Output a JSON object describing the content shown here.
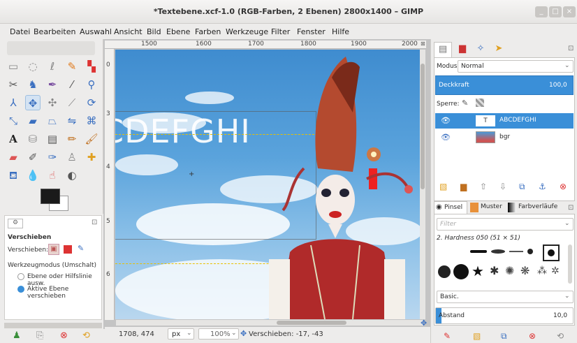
{
  "window": {
    "title": "*Textebene.xcf-1.0 (RGB-Farben, 2 Ebenen) 2800x1400 – GIMP",
    "minimize_glyph": "_",
    "maximize_glyph": "□",
    "close_glyph": "×"
  },
  "menu": [
    "Datei",
    "Bearbeiten",
    "Auswahl",
    "Ansicht",
    "Bild",
    "Ebene",
    "Farben",
    "Werkzeuge",
    "Filter",
    "Fenster",
    "Hilfe"
  ],
  "ruler": {
    "h_ticks": [
      "1500",
      "1600",
      "1700",
      "1800",
      "1900",
      "2000"
    ],
    "v_ticks": [
      "0",
      "3",
      "4",
      "5",
      "6"
    ]
  },
  "canvas": {
    "text_layer": "CDEFGHI"
  },
  "tool_options": {
    "title": "Verschieben",
    "move_label": "Verschieben:",
    "mode_label": "Werkzeugmodus (Umschalt)",
    "option_1": "Ebene oder Hilfslinie ausw.",
    "option_2": "Aktive Ebene verschieben",
    "selected_option": 2
  },
  "status": {
    "coords": "1708, 474",
    "unit": "px",
    "zoom": "100%",
    "message": "Verschieben: -17, -43"
  },
  "layers": {
    "mode_label": "Modus:",
    "mode_value": "Normal",
    "opacity_label": "Deckkraft",
    "opacity_value": "100,0",
    "lock_label": "Sperre:",
    "items": [
      {
        "name": "ABCDEFGHI",
        "selected": true
      },
      {
        "name": "bgr",
        "selected": false
      }
    ]
  },
  "brushes": {
    "tabs": [
      "Pinsel",
      "Muster",
      "Farbverläufe"
    ],
    "filter_placeholder": "Filter",
    "current_brush": "2. Hardness 050 (51 × 51)",
    "preset": "Basic.",
    "spacing_label": "Abstand",
    "spacing_value": "10,0"
  },
  "colors": {
    "accent": "#3a8fd8",
    "fg_color": "#1a1a1a",
    "bg_color": "#ffffff"
  },
  "icons": {
    "toolbox": [
      "rect-select-icon",
      "ellipse-select-icon",
      "lasso-icon",
      "fuzzy-select-icon",
      "color-select-icon",
      "scissors-icon",
      "foreground-select-icon",
      "paths-icon",
      "color-picker-icon",
      "zoom-icon",
      "measure-icon",
      "move-icon",
      "align-icon",
      "crop-icon",
      "rotate-icon",
      "scale-icon",
      "shear-icon",
      "perspective-icon",
      "flip-icon",
      "cage-icon",
      "text-icon",
      "bucket-fill-icon",
      "blend-icon",
      "pencil-icon",
      "paintbrush-icon",
      "eraser-icon",
      "airbrush-icon",
      "ink-icon",
      "clone-icon",
      "heal-icon",
      "perspective-clone-icon",
      "blur-icon",
      "smudge-icon",
      "dodge-icon"
    ]
  }
}
